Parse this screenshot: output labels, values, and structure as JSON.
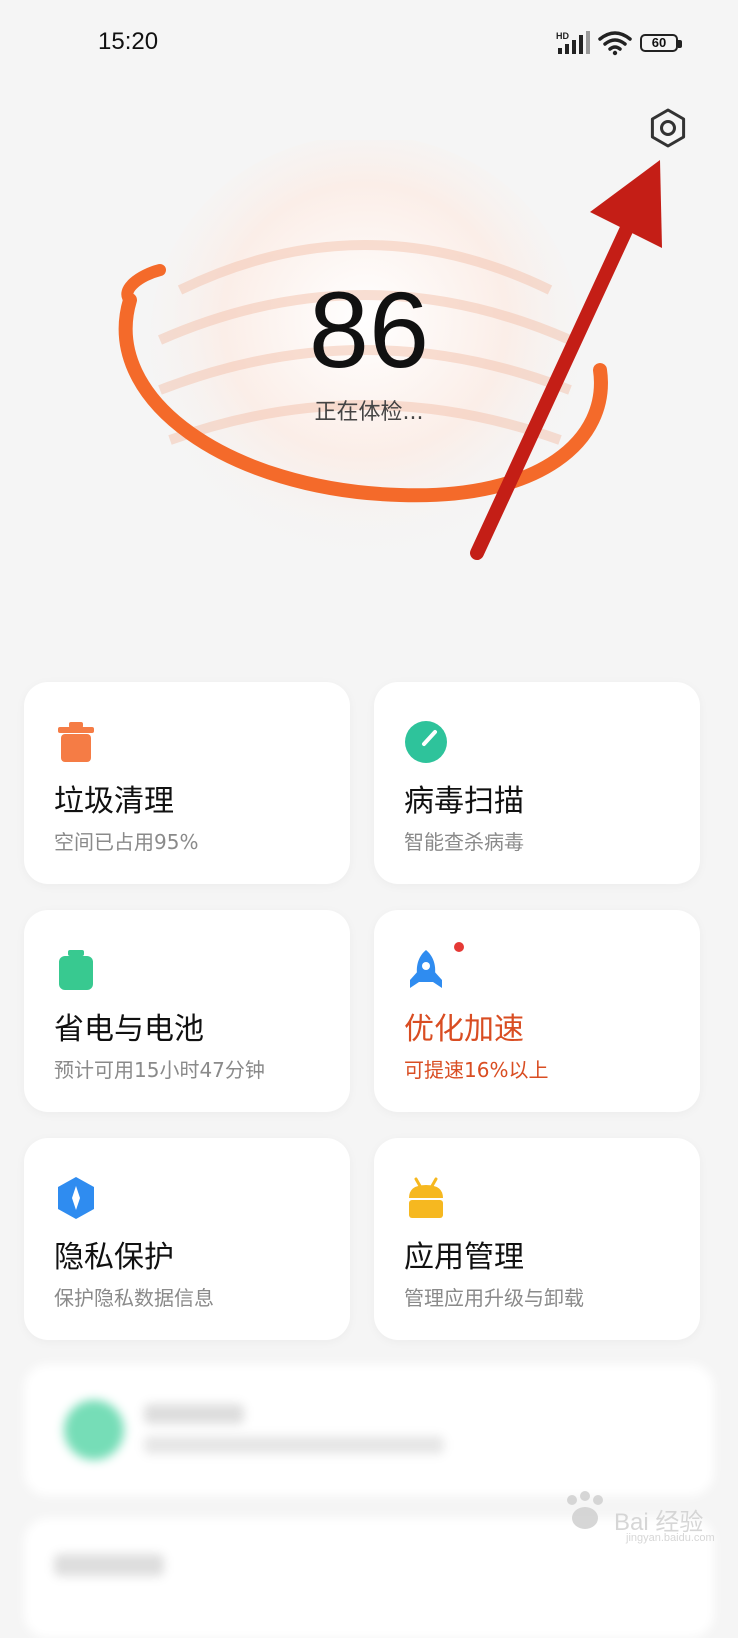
{
  "status_bar": {
    "time": "15:20",
    "network_label": "HD",
    "battery": "60"
  },
  "header": {
    "settings_icon": "gear-hexagon-icon"
  },
  "score": {
    "value": "86",
    "status": "正在体检..."
  },
  "cards": [
    {
      "title": "垃圾清理",
      "subtitle": "空间已占用95%",
      "icon": "trash-can-icon",
      "icon_color": "#f57c45"
    },
    {
      "title": "病毒扫描",
      "subtitle": "智能查杀病毒",
      "icon": "scan-gauge-icon",
      "icon_color": "#2ec39b"
    },
    {
      "title": "省电与电池",
      "subtitle": "预计可用15小时47分钟",
      "icon": "battery-icon",
      "icon_color": "#38c990"
    },
    {
      "title": "优化加速",
      "subtitle": "可提速16%以上",
      "icon": "rocket-icon",
      "icon_color": "#2f8cf0",
      "accent": "#d94d22"
    },
    {
      "title": "隐私保护",
      "subtitle": "保护隐私数据信息",
      "icon": "shield-hexagon-icon",
      "icon_color": "#2f8cf0"
    },
    {
      "title": "应用管理",
      "subtitle": "管理应用升级与卸载",
      "icon": "android-app-icon",
      "icon_color": "#f6b820"
    }
  ],
  "watermark": {
    "brand": "Bai",
    "brand_cn": "经验",
    "url": "jingyan.baidu.com"
  }
}
